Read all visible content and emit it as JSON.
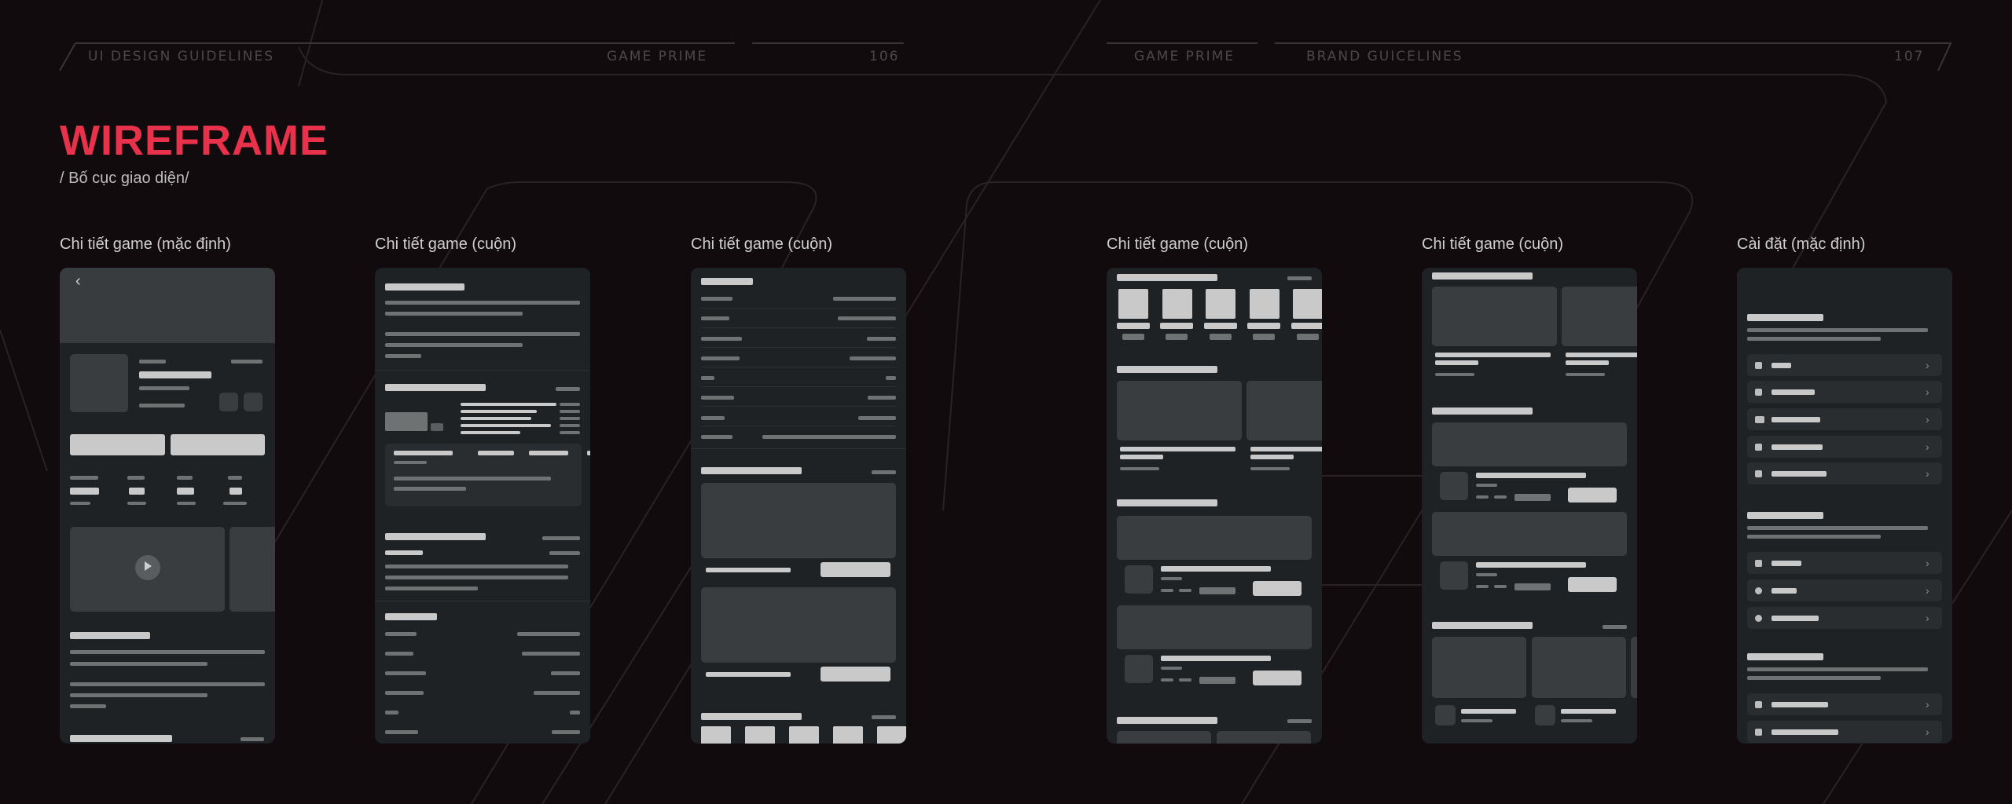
{
  "header": {
    "left_section": "UI DESIGN GUIDELINES",
    "left_brand": "GAME PRIME",
    "left_page": "106",
    "right_brand": "GAME PRIME",
    "right_section": "BRAND GUICELINES",
    "right_page": "107"
  },
  "page": {
    "title": "WIREFRAME",
    "subtitle": "/ Bố cục giao diện/"
  },
  "screens": [
    {
      "label": "Chi tiết game (mặc định)"
    },
    {
      "label": "Chi tiết game (cuộn)"
    },
    {
      "label": "Chi tiết game (cuộn)"
    },
    {
      "label": "Chi tiết game (cuộn)"
    },
    {
      "label": "Chi tiết game (cuộn)"
    },
    {
      "label": "Cài đặt (mặc định)"
    }
  ],
  "colors": {
    "background": "#120b0e",
    "accent": "#e8314a",
    "phone": "#1f2224",
    "placeholder_light": "#c9c9c9",
    "placeholder_mid": "#6f7273",
    "card": "#3a3d3f"
  },
  "icons": [
    "back-arrow-icon",
    "play-icon",
    "user-icon",
    "link-icon",
    "3d-icon",
    "shield-icon",
    "lock-icon",
    "bluetooth-icon",
    "globe-icon",
    "clock-icon",
    "bell-icon",
    "chevron-right-icon"
  ]
}
